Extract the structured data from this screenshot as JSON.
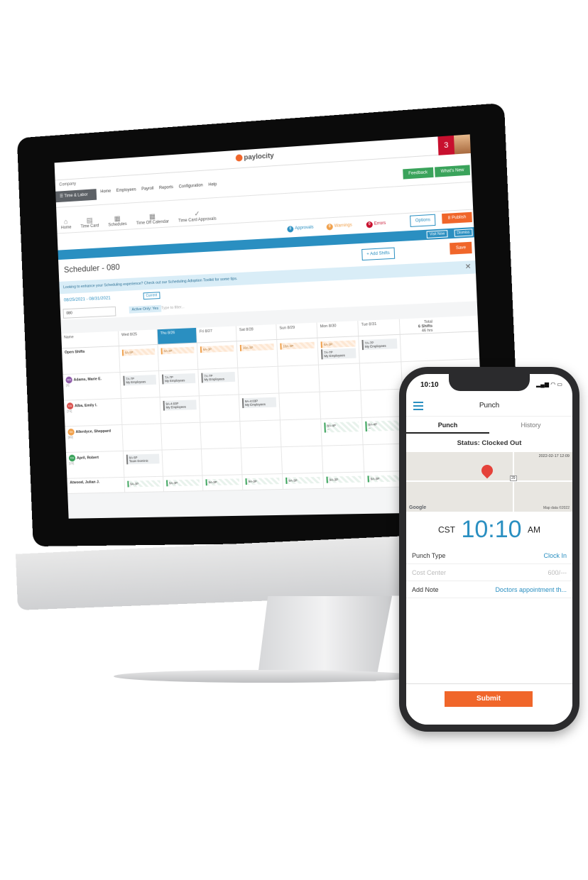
{
  "desktop": {
    "notification_count": "3",
    "logo_text": "paylocity",
    "company_label": "Company",
    "time_labor_tab": "Time & Labor",
    "menu": [
      "Home",
      "Employees",
      "Payroll",
      "Reports",
      "Configuration",
      "Help"
    ],
    "feedback_label": "Feedback",
    "whats_new_label": "What's New",
    "nav_icons": [
      {
        "label": "Home",
        "icon": "home-icon"
      },
      {
        "label": "Time Card",
        "icon": "clipboard-icon"
      },
      {
        "label": "Schedules",
        "icon": "calendar-icon"
      },
      {
        "label": "Time Off Calendar",
        "icon": "calendar-icon"
      },
      {
        "label": "Time Card Approvals",
        "icon": "check-circle-icon"
      }
    ],
    "approvals": {
      "count": "0",
      "label": "Approvals"
    },
    "warnings": {
      "count": "0",
      "label": "Warnings"
    },
    "errors": {
      "count": "0",
      "label": "Errors"
    },
    "options_label": "Options",
    "publish": {
      "count": "8",
      "label": "Publish"
    },
    "visit_now_label": "Visit Now",
    "dismiss_label": "Dismiss",
    "scheduler_title": "Scheduler - 080",
    "add_shifts_label": "+ Add Shifts",
    "save_label": "Save",
    "tip_text": "Looking to enhance your Scheduling experience? Check out our Scheduling Adoption Toolkit for some tips.",
    "date_range": "08/25/2021 - 08/31/2021",
    "current_label": "Current",
    "location_value": "080",
    "active_filter_chip": "Active Only: Yes",
    "filter_placeholder": "Type to filter...",
    "grid": {
      "name_header": "Name",
      "days": [
        "Wed 8/25",
        "Thu 8/26",
        "Fri 8/27",
        "Sat 8/28",
        "Sun 8/29",
        "Mon 8/30",
        "Tue 8/31"
      ],
      "total_header": "Total",
      "total_shifts": "6 Shifts",
      "total_hours": "46 hrs",
      "open_shifts_label": "Open Shifts",
      "rows": [
        {
          "initials": "MA",
          "color": "#8e5ba8",
          "name": "Adams, Marie E.",
          "meta": "[3]",
          "shifts": [
            {
              "day": 0,
              "time": "7A-7P",
              "note": "My Employees"
            },
            {
              "day": 1,
              "time": "7A-7P",
              "note": "My Employees"
            },
            {
              "day": 2,
              "time": "7A-7P",
              "note": "My Employees"
            }
          ]
        },
        {
          "initials": "EA",
          "color": "#d9534f",
          "name": "Alba, Emily I.",
          "meta": "[74]",
          "shifts": [
            {
              "day": 1,
              "time": "9A-4:03P",
              "note": "My Employees"
            },
            {
              "day": 3,
              "time": "9A-4:03P",
              "note": "My Employees"
            }
          ]
        },
        {
          "initials": "SA",
          "color": "#f0a04b",
          "name": "Allerdyce, Sheppard",
          "meta": "[99]",
          "shifts": [
            {
              "day": 5,
              "time": "8A-4P",
              "note": "--",
              "green": true
            },
            {
              "day": 6,
              "time": "8A-4P",
              "note": "--",
              "green": true
            }
          ]
        },
        {
          "initials": "RA",
          "color": "#3aa35b",
          "name": "April, Robert",
          "meta": "[25]",
          "shifts": [
            {
              "day": 0,
              "time": "8A-5P",
              "note": "Team Dominic"
            }
          ]
        }
      ],
      "open_shifts": [
        {
          "day": 0,
          "time": "6A-5P"
        },
        {
          "day": 1,
          "time": "6A-3P"
        },
        {
          "day": 2,
          "time": "6A-3P"
        },
        {
          "day": 3,
          "time": "10A-3P"
        },
        {
          "day": 4,
          "time": "10A-3P"
        },
        {
          "day": 5,
          "time": "6A-3P"
        }
      ],
      "open_emp_shifts": [
        {
          "day": 5,
          "time": "7A-7P",
          "note": "My Employees"
        },
        {
          "day": 6,
          "time": "7A-7P",
          "note": "My Employees"
        }
      ],
      "last_row_name": "Atwood, Julian J.",
      "last_row_shifts": [
        "9A-3P",
        "9A-3P",
        "9A-3P",
        "9A-3P",
        "9A-3P",
        "9A-3P",
        "9A-3P"
      ]
    }
  },
  "phone": {
    "status_time": "10:10",
    "header_title": "Punch",
    "tabs": [
      "Punch",
      "History"
    ],
    "status_text": "Status: Clocked Out",
    "map_timestamp": "2022-02-17 12:09",
    "map_google": "Google",
    "map_data": "Map data ©2022",
    "map_road_label": "29",
    "clock_tz": "CST",
    "clock_time": "10:10",
    "clock_ampm": "AM",
    "fields": [
      {
        "label": "Punch Type",
        "value": "Clock In",
        "disabled": false
      },
      {
        "label": "Cost Center",
        "value": "600/---",
        "disabled": true
      },
      {
        "label": "Add Note",
        "value": "Doctors appointment th...",
        "disabled": false
      }
    ],
    "submit_label": "Submit"
  },
  "colors": {
    "accent_blue": "#2a8fc1",
    "brand_orange": "#f0662a",
    "success_green": "#3aa35b",
    "error_red": "#c8102e"
  }
}
